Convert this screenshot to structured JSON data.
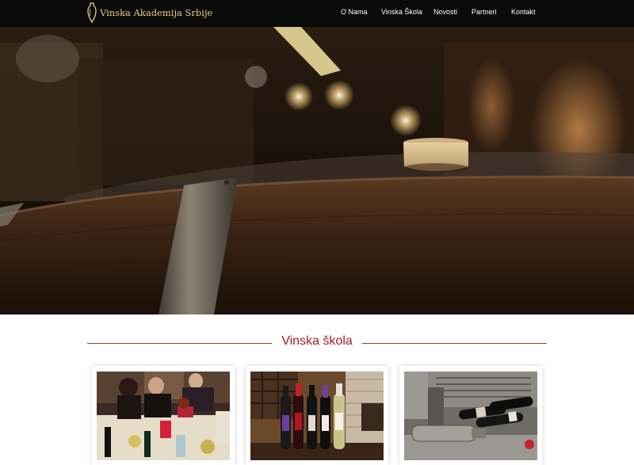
{
  "header": {
    "brand_name": "Vinska Akademija Srbije",
    "logo_icon": "amphora-icon",
    "nav": [
      {
        "label": "O Nama"
      },
      {
        "label": "Vinska Škola"
      },
      {
        "label": "Novosti"
      },
      {
        "label": "Partneri"
      },
      {
        "label": "Kontakt"
      }
    ]
  },
  "hero": {
    "image": "wine-barrel-cellar-photo"
  },
  "section": {
    "title": "Vinska škola",
    "cards": [
      {
        "image": "wine-tasting-class-photo"
      },
      {
        "image": "wine-bottles-shelf-photo"
      },
      {
        "image": "cellar-bottles-photo"
      }
    ]
  },
  "colors": {
    "nav_background": "#0a0a0a",
    "brand_gold": "#e7cc8b",
    "accent_red": "#a32025"
  }
}
